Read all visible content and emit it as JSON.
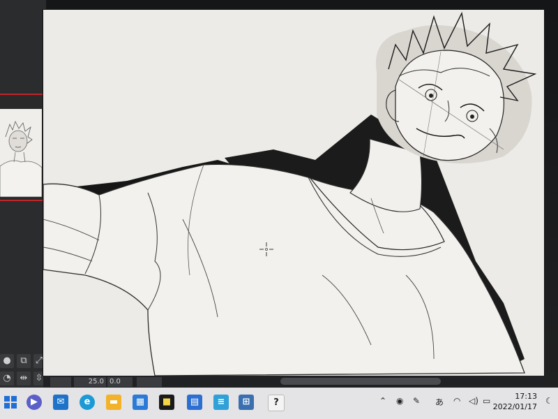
{
  "app": {
    "status": {
      "brush_size": "25.0",
      "rotation": "0.0"
    }
  },
  "taskbar": {
    "apps": [
      {
        "name": "start-button",
        "icon": "windows-icon",
        "color": "#1f6fd6"
      },
      {
        "name": "teams",
        "icon": "video-chat-icon",
        "color": "#5b5fc7"
      },
      {
        "name": "mail",
        "icon": "mail-icon",
        "color": "#1e73c8"
      },
      {
        "name": "edge",
        "icon": "edge-icon",
        "color": "#1b9ad6"
      },
      {
        "name": "explorer",
        "icon": "folder-icon",
        "color": "#f2b32a"
      },
      {
        "name": "store",
        "icon": "store-icon",
        "color": "#2a7ad6"
      },
      {
        "name": "sticky",
        "icon": "sticky-note-icon",
        "color": "#1a1a1a"
      },
      {
        "name": "calendar",
        "icon": "calendar-icon",
        "color": "#2d6fd0"
      },
      {
        "name": "notepad",
        "icon": "notepad-icon",
        "color": "#2fa0d8"
      },
      {
        "name": "calculator",
        "icon": "calculator-icon",
        "color": "#3a6fb0"
      },
      {
        "name": "paint-app",
        "icon": "paint-app-icon",
        "color": "#f4f4f4"
      }
    ],
    "tray": {
      "ime": "あ",
      "time": "17:13",
      "date": "2022/01/17"
    }
  }
}
